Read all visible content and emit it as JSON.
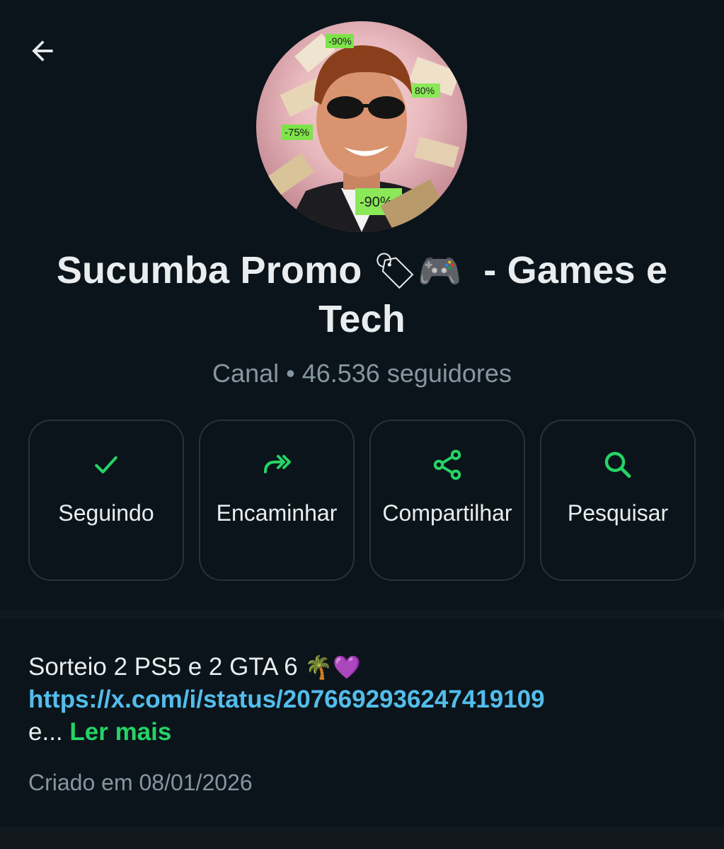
{
  "channel": {
    "name": "Sucumba Promo",
    "name_emoji": "🏷🎮",
    "name_suffix": "- Games e Tech",
    "meta": "Canal • 46.536 seguidores"
  },
  "avatar": {
    "tags": [
      "-90%",
      "80%",
      "-75%",
      "-90%"
    ]
  },
  "actions": [
    {
      "label": "Seguindo",
      "icon": "check-icon"
    },
    {
      "label": "Encaminhar",
      "icon": "forward-icon"
    },
    {
      "label": "Compartilhar",
      "icon": "share-icon"
    },
    {
      "label": "Pesquisar",
      "icon": "search-icon"
    }
  ],
  "description": {
    "text": "Sorteio 2 PS5 e 2 GTA 6",
    "emoji": "🌴💜",
    "link": "https://x.com/i/status/2076692936247419109",
    "truncated": "e...",
    "read_more": "Ler mais"
  },
  "created": "Criado em 08/01/2026",
  "colors": {
    "background": "#0b141a",
    "accent": "#25d366",
    "link": "#53bdeb",
    "muted": "#8696a0",
    "button_border": "#2a3237"
  }
}
